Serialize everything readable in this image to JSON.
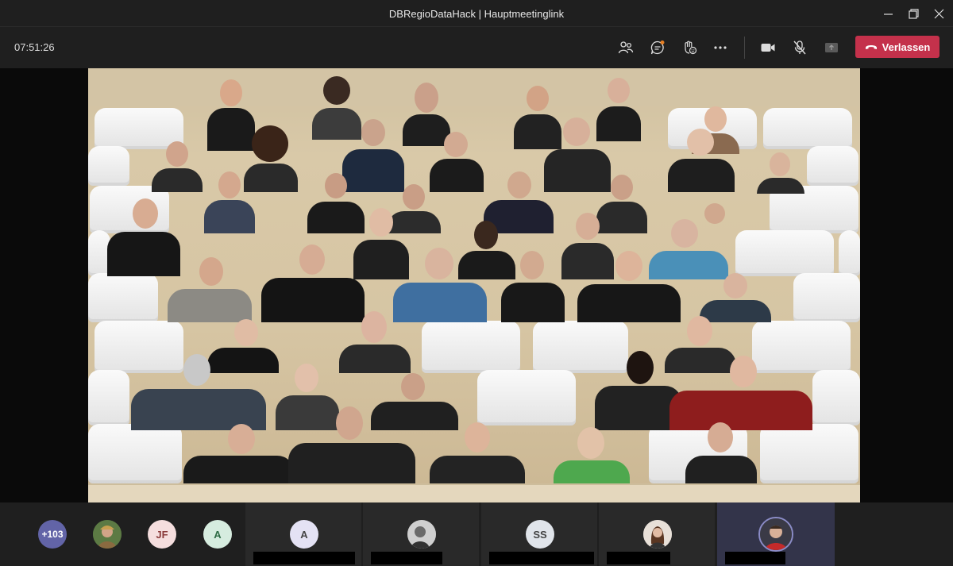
{
  "window": {
    "title": "DBRegioDataHack | Hauptmeetinglink"
  },
  "toolbar": {
    "clock": "07:51:26",
    "icons": [
      "people-icon",
      "chat-icon",
      "reactions-icon",
      "more-icon",
      "camera-icon",
      "mic-muted-icon",
      "share-icon"
    ],
    "leave_label": "Verlassen",
    "leave_color": "#c4314b"
  },
  "participants": {
    "overflow_count": "+103",
    "avatars": [
      {
        "initials": "JF",
        "bg": "#f5dede",
        "fg": "#8a3a3a"
      },
      {
        "initials": "A",
        "bg": "#d6ecdf",
        "fg": "#2e6b45"
      }
    ],
    "tiles": [
      {
        "initials": "A",
        "bg": "#e4e2f4",
        "fg": "#444"
      },
      {
        "initials": "SS",
        "bg": "#e0e4ea",
        "fg": "#444"
      }
    ]
  },
  "colors": {
    "app_bg": "#1f1f1f",
    "accent": "#6264a7"
  }
}
